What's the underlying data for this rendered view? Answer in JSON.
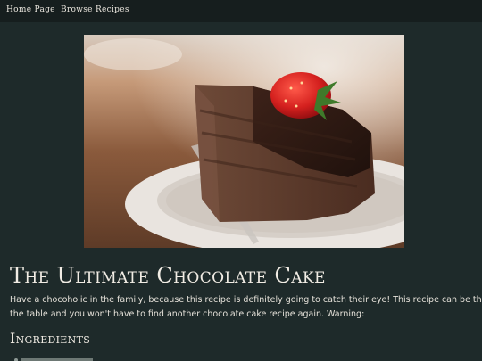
{
  "nav": {
    "items": [
      {
        "label": "Home Page"
      },
      {
        "label": "Browse Recipes"
      }
    ]
  },
  "hero": {
    "image": "chocolate-cake-slice-with-strawberry"
  },
  "recipe": {
    "title": "The Ultimate Chocolate Cake",
    "description_lines": [
      "Have a chocoholic in the family, because this recipe is definitely going to catch their eye! This recipe can be the star of",
      "the table and you won't have to find another chocolate cake recipe again. Warning:"
    ],
    "ingredients_heading": "Ingredients"
  },
  "colors": {
    "page_background": "#1e2a2a",
    "navbar_background": "#161e1e",
    "text": "#ece8e2"
  }
}
